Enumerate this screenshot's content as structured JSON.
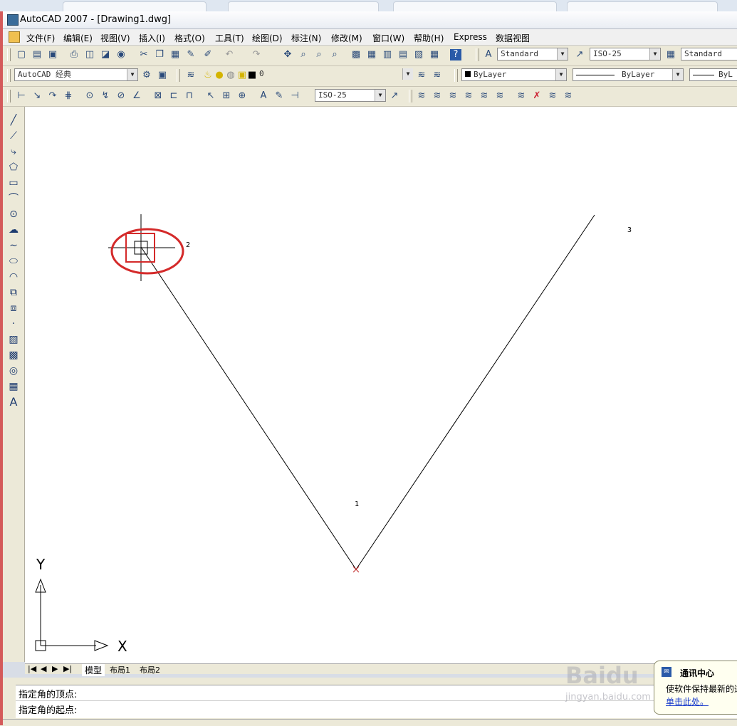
{
  "window": {
    "title": "AutoCAD 2007 - [Drawing1.dwg]"
  },
  "menubar": {
    "items": [
      "文件(F)",
      "编辑(E)",
      "视图(V)",
      "插入(I)",
      "格式(O)",
      "工具(T)",
      "绘图(D)",
      "标注(N)",
      "修改(M)",
      "窗口(W)",
      "帮助(H)",
      "Express",
      "数据视图"
    ]
  },
  "toolbar1": {
    "text_style": "Standard",
    "dim_style": "ISO-25",
    "table_style": "Standard"
  },
  "toolbar2": {
    "workspace": "AutoCAD 经典",
    "layer": "0",
    "color": "ByLayer",
    "linetype": "ByLayer",
    "lineweight": "ByL"
  },
  "toolbar3": {
    "dim_style": "ISO-25"
  },
  "drawing": {
    "point_labels": [
      "1",
      "2",
      "3"
    ],
    "ucs_x": "X",
    "ucs_y": "Y"
  },
  "layout_tabs": [
    "模型",
    "布局1",
    "布局2"
  ],
  "command": {
    "line1": "指定角的顶点:",
    "line2": "指定角的起点:"
  },
  "balloon": {
    "title": "通讯中心",
    "body": "使软件保持最新的通",
    "link": "单击此处。"
  },
  "watermark": {
    "main": "Baidu",
    "sub": "jingyan.baidu.com"
  },
  "colors": {
    "highlight_circle": "#d42a2a",
    "frame_accent": "#d45a5a",
    "drawing_line": "#000000"
  }
}
